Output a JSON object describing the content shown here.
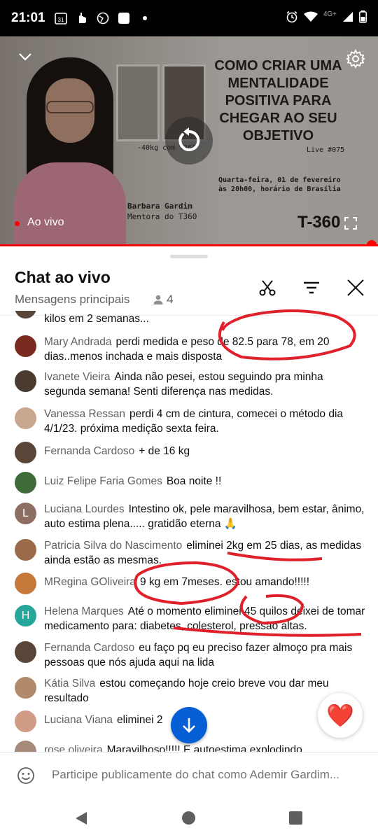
{
  "status_bar": {
    "time": "21:01",
    "calendar_day": "31",
    "network": "4G+"
  },
  "video": {
    "thumbnail_title": "COMO CRIAR UMA MENTALIDADE POSITIVA PARA CHEGAR AO SEU OBJETIVO",
    "thumbnail_caption": "-40kg com T360",
    "thumbnail_live": "Live #075",
    "thumbnail_date_line1": "Quarta-feira, 01 de fevereiro",
    "thumbnail_date_line2": "às 20h00, horário de Brasília",
    "thumbnail_name": "Barbara Gardim",
    "thumbnail_role": "Mentora do T360",
    "thumbnail_logo": "T-360",
    "live_label": "Ao vivo",
    "accent_color": "#ff0000"
  },
  "chat": {
    "title": "Chat ao vivo",
    "subtitle": "Mensagens principais",
    "viewer_count": "4",
    "partial_top": "kilos em 2 semanas...",
    "messages": [
      {
        "author": "Mary Andrada",
        "text": "perdi medida e peso de 82.5 para 78, em 20 dias..menos inchada e mais disposta",
        "avatar_color": "#7a2a1e"
      },
      {
        "author": "Ivanete Vieira",
        "text": "Ainda não pesei, estou seguindo pra minha segunda semana! Senti diferença nas medidas.",
        "avatar_color": "#4b3a30"
      },
      {
        "author": "Vanessa Ressan",
        "text": "perdi 4 cm de cintura, comecei o método dia 4/1/23. próxima medição sexta feira.",
        "avatar_color": "#c9a68e"
      },
      {
        "author": "Fernanda Cardoso",
        "text": "+ de 16 kg",
        "avatar_color": "#5a4638"
      },
      {
        "author": "Luiz Felipe Faria Gomes",
        "text": "Boa noite !!",
        "avatar_color": "#3f6a3a"
      },
      {
        "author": "Luciana Lourdes",
        "text": "Intestino ok, pele maravilhosa, bem estar, ânimo, auto estima plena..... gratidão eterna 🙏",
        "avatar_letter": "L",
        "avatar_color": "#8d6e63"
      },
      {
        "author": "Patricia Silva do Nascimento",
        "text": "eliminei 2kg em 25 dias, as medidas ainda estão as mesmas.",
        "avatar_color": "#9b6a4a"
      },
      {
        "author": "MRegina GOliveira",
        "text": "9 kg em 7meses. estou amando!!!!!",
        "avatar_color": "#c4793a"
      },
      {
        "author": "Helena Marques",
        "text": "Até o momento eliminei 45 quilos deixei de tomar medicamento para: diabetes, colesterol, pressão altas.",
        "avatar_letter": "H",
        "avatar_color": "#26a69a"
      },
      {
        "author": "Fernanda Cardoso",
        "text": "eu faço pq eu preciso fazer almoço pra mais pessoas que nós ajuda aqui na lida",
        "avatar_color": "#5a4638"
      },
      {
        "author": "Kátia Silva",
        "text": "estou começando hoje creio breve vou dar meu resultado",
        "avatar_color": "#b08a6a"
      },
      {
        "author": "Luciana Viana",
        "text": "eliminei 2",
        "avatar_color": "#d19c86"
      },
      {
        "author": "rose oliveira",
        "text": "Maravilhoso!!!!! E autoestima explodindo",
        "avatar_color": "#a58a7a"
      }
    ],
    "input_placeholder": "Participe publicamente do chat como Ademir Gardim...",
    "heart_emoji": "❤️"
  }
}
